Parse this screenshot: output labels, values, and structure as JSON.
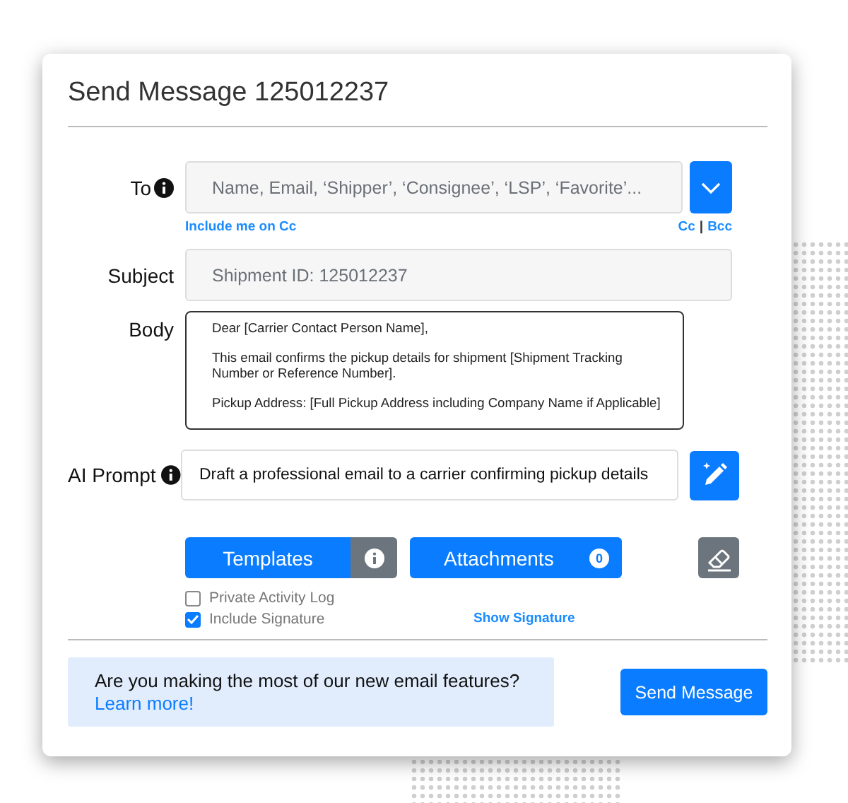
{
  "window": {
    "title": "Send Message 125012237"
  },
  "to": {
    "label": "To",
    "placeholder": "Name, Email, ‘Shipper’, ‘Consignee’, ‘LSP’, ‘Favorite’...",
    "include_me_link": "Include me on Cc",
    "cc_link": "Cc",
    "separator": "|",
    "bcc_link": "Bcc"
  },
  "subject": {
    "label": "Subject",
    "value": "Shipment ID: 125012237"
  },
  "body": {
    "label": "Body",
    "paragraphs": [
      "Dear [Carrier Contact Person Name],",
      "This email confirms the pickup details for shipment [Shipment Tracking Number or Reference Number].",
      "Pickup Address: [Full Pickup Address including Company Name if Applicable]"
    ]
  },
  "ai_prompt": {
    "label": "AI Prompt",
    "value": "Draft a professional email to a carrier confirming pickup details"
  },
  "actions": {
    "templates": "Templates",
    "attachments": "Attachments",
    "attachment_count": "0"
  },
  "options": [
    {
      "label": "Private Activity Log",
      "checked": false
    },
    {
      "label": "Include Signature",
      "checked": true
    }
  ],
  "show_signature_link": "Show Signature",
  "banner": {
    "text": "Are you making the most of our new email features?",
    "link": "Learn more!"
  },
  "send_button": "Send Message"
}
